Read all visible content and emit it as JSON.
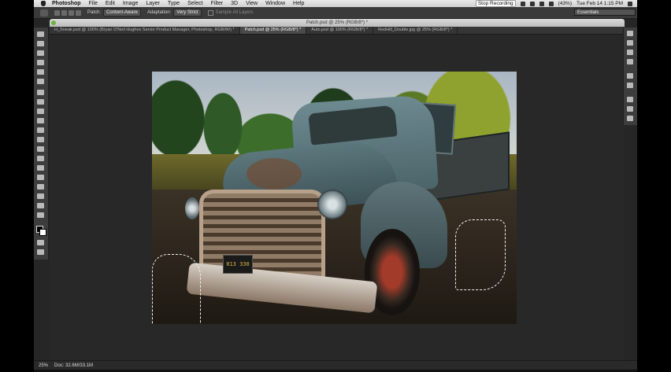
{
  "menubar": {
    "items": [
      "Photoshop",
      "File",
      "Edit",
      "Image",
      "Layer",
      "Type",
      "Select",
      "Filter",
      "3D",
      "View",
      "Window",
      "Help"
    ],
    "recording": "Stop Recording",
    "battery": "(43%)",
    "clock": "Tue Feb 14  1:15 PM"
  },
  "options": {
    "patch_label": "Patch:",
    "patch_value": "Content-Aware",
    "adaptation_label": "Adaptation:",
    "adaptation_value": "Very Strict",
    "sample_all": "Sample All Layers",
    "workspace": "Essentials"
  },
  "document": {
    "window_title": "Patch.psd @ 25% (RGB/8*) *",
    "tabs": [
      {
        "label": "H_Sneak.psd @ 100% (Bryan O'Neil Hughes Senior Product Manager, Photoshop, RGB/8#) *",
        "active": false
      },
      {
        "label": "Patch.psd @ 25% (RGB/8*) *",
        "active": true
      },
      {
        "label": "Auto.psd @ 100% (RGB/8*) *",
        "active": false
      },
      {
        "label": "RedHill_Double.jpg @ 25% (RGB/8*) *",
        "active": false
      }
    ],
    "plate_text": "013 330"
  },
  "status": {
    "zoom": "25%",
    "doc_size": "Doc: 32.6M/33.1M"
  }
}
